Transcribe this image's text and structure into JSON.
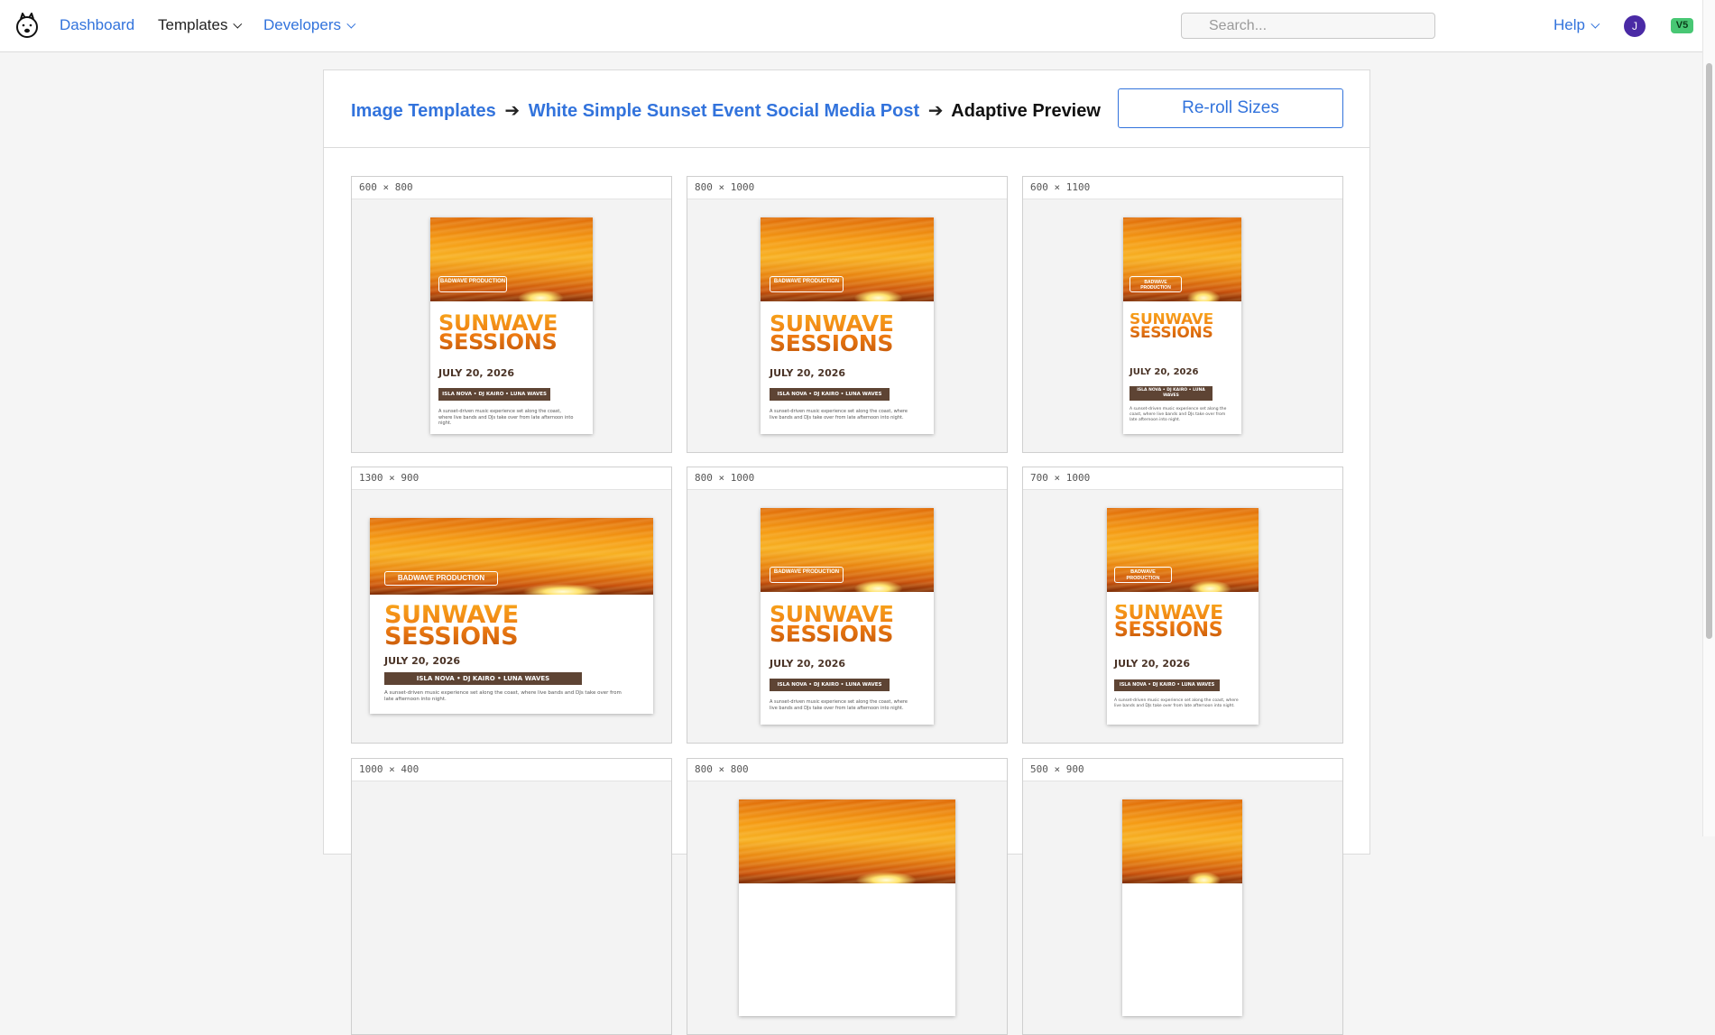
{
  "nav": {
    "dashboard": "Dashboard",
    "templates": "Templates",
    "developers": "Developers",
    "search_placeholder": "Search...",
    "help": "Help",
    "avatar_initial": "J",
    "version_badge": "V5"
  },
  "breadcrumb": {
    "root": "Image Templates",
    "arrow": "➔",
    "template": "White Simple Sunset Event Social Media Post",
    "current": "Adaptive Preview"
  },
  "reroll_label": "Re-roll Sizes",
  "poster": {
    "badge": "BADWAVE PRODUCTION",
    "title_line1": "SUNWAVE",
    "title_line2": "SESSIONS",
    "date": "JULY 20, 2026",
    "lineup": "ISLA NOVA • DJ KAIRO • LUNA WAVES",
    "description": "A sunset-driven music experience set along the coast, where live bands and DJs take over from late afternoon into night."
  },
  "tiles": [
    {
      "size": "600 × 800"
    },
    {
      "size": "800 × 1000"
    },
    {
      "size": "600 × 1100"
    },
    {
      "size": "1300 × 900"
    },
    {
      "size": "800 × 1000"
    },
    {
      "size": "700 × 1000"
    },
    {
      "size": "1000 × 400"
    },
    {
      "size": "800 × 800"
    },
    {
      "size": "500 × 900"
    }
  ],
  "colors": {
    "link": "#3273dc",
    "lineup_bar": "#5e4434",
    "version_badge": "#48c774",
    "avatar": "#4a2aa5"
  }
}
